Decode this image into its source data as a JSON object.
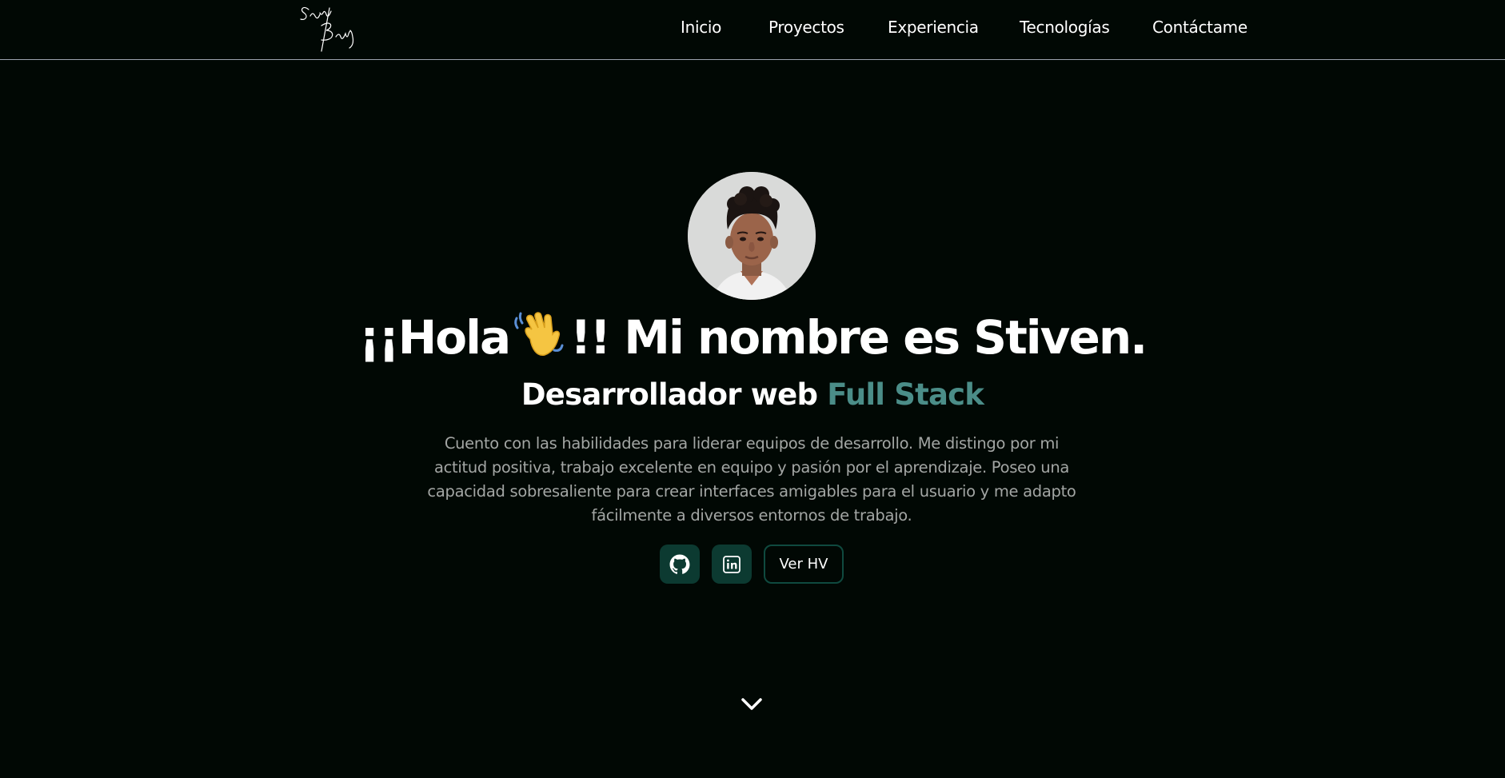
{
  "header": {
    "logo_alt": "Sven Benji",
    "nav": [
      {
        "label": "Inicio"
      },
      {
        "label": "Proyectos"
      },
      {
        "label": "Experiencia"
      },
      {
        "label": "Tecnologías"
      },
      {
        "label": "Contáctame"
      }
    ]
  },
  "hero": {
    "greeting_prefix": "¡¡Hola",
    "greeting_suffix": "!! Mi nombre es Stiven.",
    "wave_icon": "waving-hand-icon",
    "subtitle_main": "Desarrollador web",
    "subtitle_accent": "Full Stack",
    "description": "Cuento con las habilidades para liderar equipos de desarrollo. Me distingo por mi actitud positiva, trabajo excelente en equipo y pasión por el aprendizaje. Poseo una capacidad sobresaliente para crear interfaces amigables para el usuario y me adapto fácilmente a diversos entornos de trabajo.",
    "buttons": {
      "github_icon": "github-icon",
      "linkedin_icon": "linkedin-icon",
      "cv_label": "Ver HV"
    },
    "scroll_icon": "chevron-down-icon"
  },
  "colors": {
    "background": "#010804",
    "accent": "#4b8d88",
    "button_bg": "#0c3a31",
    "text": "#ffffff",
    "muted_text": "#a3a6a4"
  }
}
